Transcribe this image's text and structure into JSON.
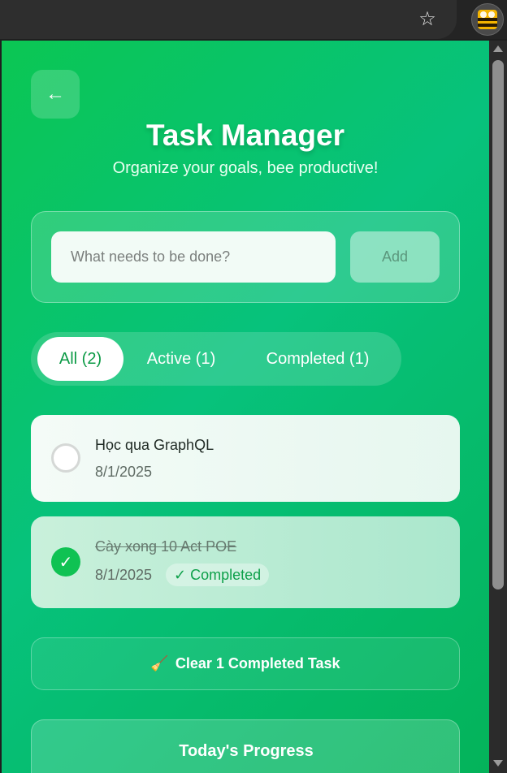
{
  "browser": {
    "star_icon": "☆",
    "extension_icon": "bee-extension-icon"
  },
  "header": {
    "back_icon": "←",
    "title": "Task Manager",
    "subtitle": "Organize your goals, bee productive!"
  },
  "add_task": {
    "placeholder": "What needs to be done?",
    "value": "",
    "add_label": "Add"
  },
  "filters": [
    {
      "label": "All (2)",
      "active": true
    },
    {
      "label": "Active (1)",
      "active": false
    },
    {
      "label": "Completed (1)",
      "active": false
    }
  ],
  "tasks": [
    {
      "text": "Học qua GraphQL",
      "date": "8/1/2025",
      "completed": false
    },
    {
      "text": "Cày xong 10 Act POE",
      "date": "8/1/2025",
      "completed": true,
      "badge": "✓ Completed",
      "check_icon": "✓"
    }
  ],
  "clear": {
    "icon": "🧹",
    "label": "Clear 1 Completed Task"
  },
  "progress": {
    "title": "Today's Progress"
  },
  "colors": {
    "accent": "#0bc653",
    "accent_dark": "#0b9a45",
    "completed_text": "#0ea04a"
  }
}
